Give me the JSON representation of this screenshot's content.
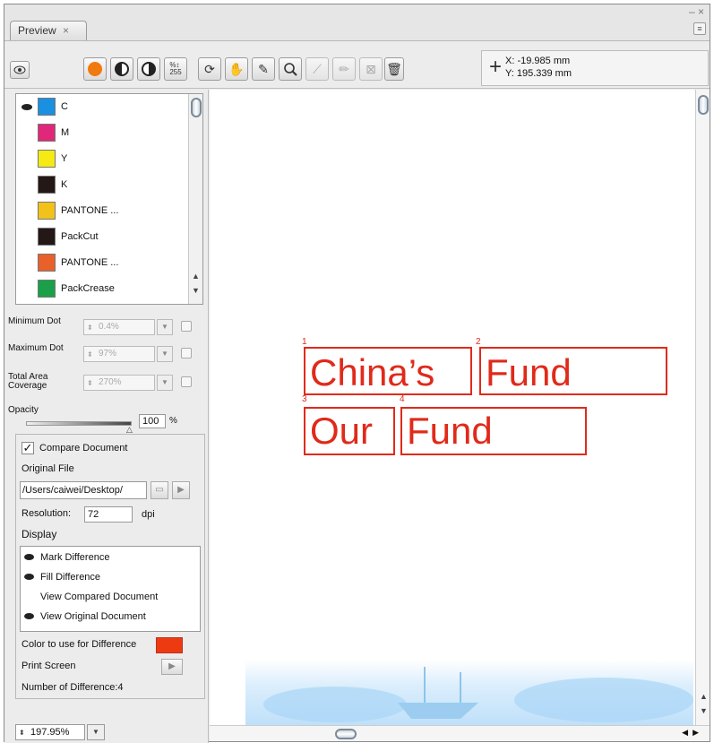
{
  "window": {
    "tab_label": "Preview",
    "tab_close": "×",
    "ctrl_minus_close": "– ×"
  },
  "coords": {
    "x_label": "X:",
    "x_value": "-19.985 mm",
    "y_label": "Y:",
    "y_value": "195.339 mm"
  },
  "separations": [
    {
      "name": "C",
      "color": "#1a90e0",
      "visible": true
    },
    {
      "name": "M",
      "color": "#e0277a",
      "visible": false
    },
    {
      "name": "Y",
      "color": "#f5ea14",
      "visible": false
    },
    {
      "name": "K",
      "color": "#231815",
      "visible": false
    },
    {
      "name": "PANTONE ...",
      "color": "#f2c21a",
      "visible": false
    },
    {
      "name": "PackCut",
      "color": "#231815",
      "visible": false
    },
    {
      "name": "PANTONE ...",
      "color": "#e8602a",
      "visible": false
    },
    {
      "name": "PackCrease",
      "color": "#1aa048",
      "visible": false
    }
  ],
  "params": {
    "min_dot_label": "Minimum Dot",
    "min_dot_value": "0.4%",
    "max_dot_label": "Maximum Dot",
    "max_dot_value": "97%",
    "tac_label": "Total Area Coverage",
    "tac_value": "270%",
    "opacity_label": "Opacity",
    "opacity_value": "100",
    "opacity_unit": "%"
  },
  "compare": {
    "compare_label": "Compare Document",
    "compare_checked": "✓",
    "original_file_label": "Original File",
    "original_file_path": "/Users/caiwei/Desktop/",
    "resolution_label": "Resolution:",
    "resolution_value": "72",
    "resolution_unit": "dpi",
    "display_label": "Display",
    "display_items": [
      {
        "label": "Mark Difference",
        "visible": true
      },
      {
        "label": "Fill Difference",
        "visible": true
      },
      {
        "label": "View Compared Document",
        "visible": false
      },
      {
        "label": "View Original Document",
        "visible": true
      }
    ],
    "color_label": "Color to use for Difference",
    "difference_color": "#ee3a11",
    "print_screen_label": "Print Screen",
    "diff_count_label": "Number of Difference:4"
  },
  "zoom": {
    "value": "197.95%"
  },
  "canvas": {
    "words": [
      {
        "num": "1",
        "text": "China’s"
      },
      {
        "num": "2",
        "text": "Fund"
      },
      {
        "num": "3",
        "text": "Our"
      },
      {
        "num": "4",
        "text": "Fund"
      }
    ],
    "mark_color": "#e02a1a"
  }
}
